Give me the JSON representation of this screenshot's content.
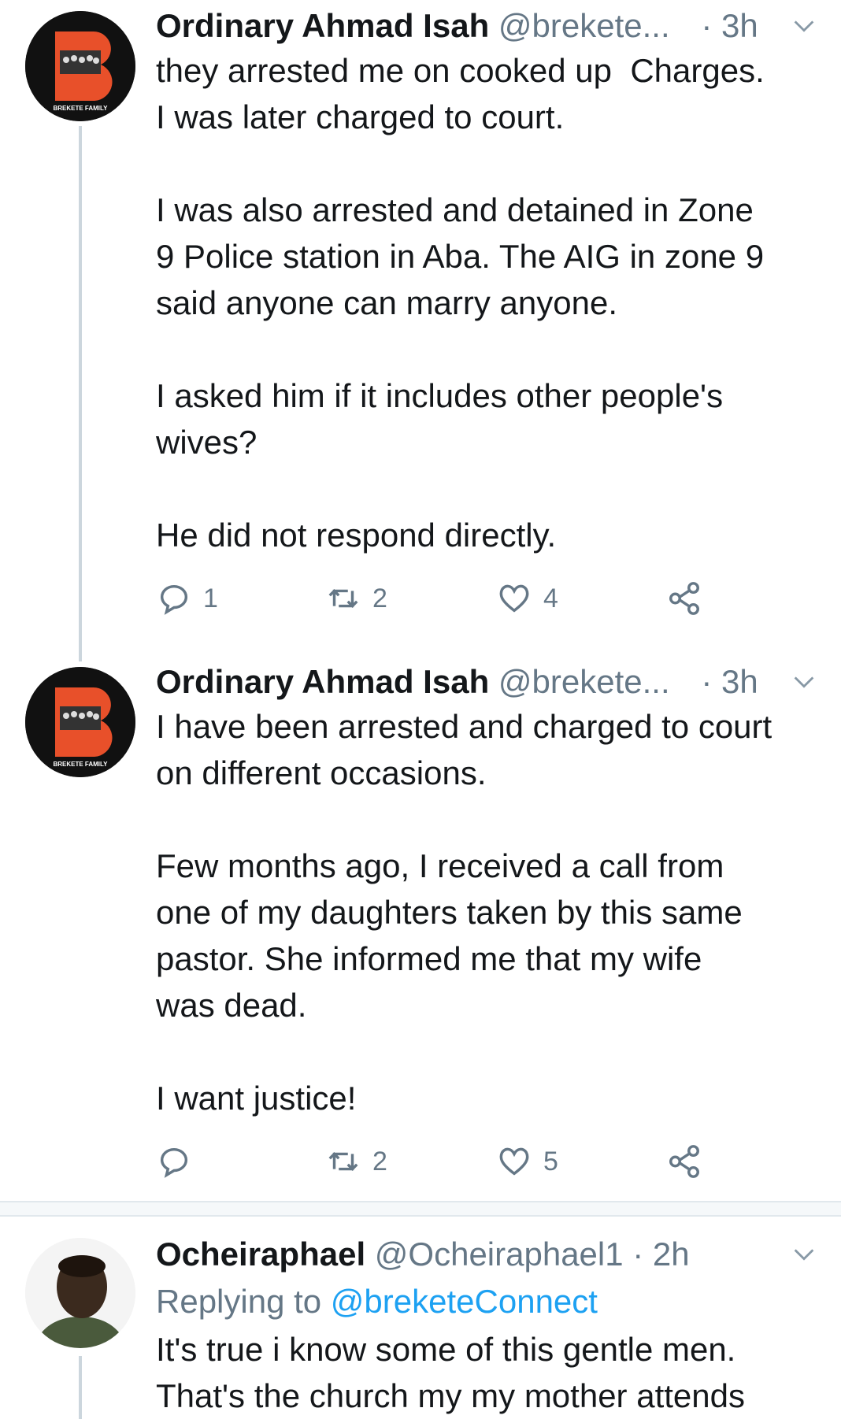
{
  "tweets": [
    {
      "name": "Ordinary Ahmad Isah",
      "handle": "@brekete...",
      "time": "· 3h",
      "avatar_icon": "brekete-family-logo",
      "avatar_text": "BREKETE FAMILY",
      "body": "they arrested me on cooked up  Charges.\nI was later charged to court.\n\nI was also arrested and detained in Zone\n9 Police station in Aba. The AIG in zone 9\nsaid anyone can marry anyone.\n\nI asked him if it includes other people's\nwives?\n\nHe did not respond directly.",
      "replies": "1",
      "retweets": "2",
      "likes": "4"
    },
    {
      "name": "Ordinary Ahmad Isah",
      "handle": "@brekete...",
      "time": "· 3h",
      "avatar_icon": "brekete-family-logo",
      "avatar_text": "BREKETE FAMILY",
      "body": "I have been arrested and charged to court\non different occasions.\n\nFew months ago, I received a call from\none of my daughters taken by this same\npastor. She informed me that my wife\nwas dead.\n\nI want justice!",
      "replies": "",
      "retweets": "2",
      "likes": "5"
    },
    {
      "name": "Ocheiraphael",
      "handle": "@Ocheiraphael1",
      "time": "· 2h",
      "avatar_icon": "user-photo",
      "replying_label": "Replying to",
      "replying_handle": "@breketeConnect",
      "body": "It's true i know some of this gentle men.\nThat's the church my my mother attends"
    }
  ],
  "colors": {
    "text": "#14171a",
    "muted": "#657786",
    "link": "#1da1f2",
    "line": "#ccd6dd"
  }
}
